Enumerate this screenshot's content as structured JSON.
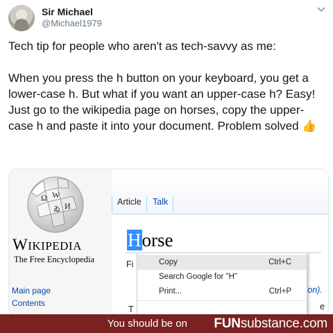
{
  "tweet": {
    "author_name": "Sir Michael",
    "author_handle": "@Michael1979",
    "menu_icon": "chevron-down-icon",
    "line1": "Tech tip for people who aren't as tech-savvy as me:",
    "line2": "When you press the h button on your keyboard, you get a lower-case h. But what if you want an upper-case h? Easy! Just go to the wikipedia page on horses, copy the upper-case h and paste it into your document. Problem solved",
    "emoji": "👍"
  },
  "wikipedia": {
    "globe_glyphs": [
      "Ω",
      "W",
      "И",
      "ゐ"
    ],
    "wordmark_first": "W",
    "wordmark_rest": "IKIPEDIA",
    "tagline": "The Free Encyclopedia",
    "nav_main_page": "Main page",
    "nav_contents": "Contents",
    "tab_article": "Article",
    "tab_talk": "Talk",
    "title_selected": "H",
    "title_rest": "orse",
    "fragment_left": "Fi",
    "fragment_right": "tion).",
    "fragment_bottom": "T",
    "fragment_bottom_right": "e"
  },
  "context_menu": {
    "items": [
      {
        "label": "Copy",
        "shortcut": "Ctrl+C"
      },
      {
        "label": "Search Google for \"H\"",
        "shortcut": ""
      },
      {
        "label": "Print...",
        "shortcut": "Ctrl+P"
      }
    ]
  },
  "footer": {
    "text": "You should be on",
    "brand_bold": "FUN",
    "brand_rest": "substance.com",
    "color": "#7a2222"
  }
}
